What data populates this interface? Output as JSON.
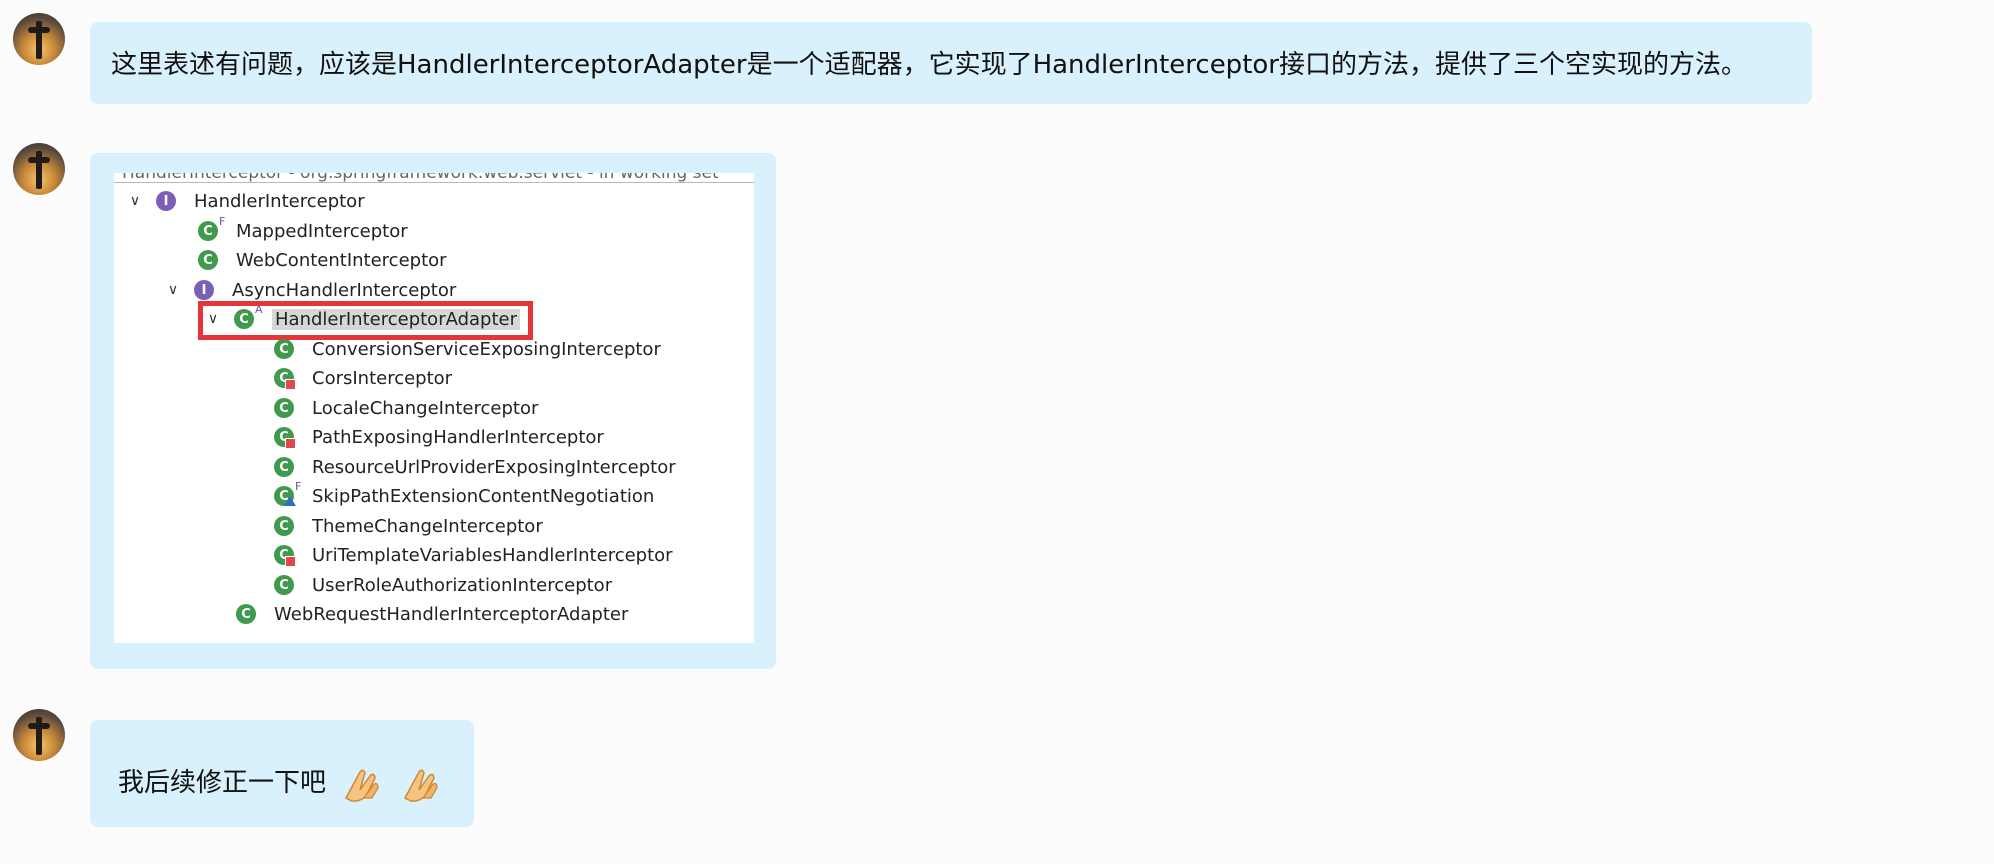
{
  "messages": [
    {
      "avatar_icon": "seattle-tower-sunset-avatar",
      "text": "这里表述有问题，应该是HandlerInterceptorAdapter是一个适配器，它实现了HandlerInterceptor接口的方法，提供了三个空实现的方法。"
    },
    {
      "avatar_icon": "seattle-tower-sunset-avatar",
      "screenshot": {
        "crumb": "HandlerInterceptor - org.springframework.web.servlet - in working set",
        "tree": [
          {
            "label": "HandlerInterceptor",
            "icon": "interface-icon",
            "expanded": true
          },
          {
            "label": "MappedInterceptor",
            "icon": "class-icon",
            "modifier": "F"
          },
          {
            "label": "WebContentInterceptor",
            "icon": "class-icon"
          },
          {
            "label": "AsyncHandlerInterceptor",
            "icon": "interface-icon",
            "expanded": true
          },
          {
            "label": "HandlerInterceptorAdapter",
            "icon": "class-icon",
            "modifier": "A",
            "expanded": true,
            "selected": true
          },
          {
            "label": "ConversionServiceExposingInterceptor",
            "icon": "class-icon"
          },
          {
            "label": "CorsInterceptor",
            "icon": "class-icon",
            "badge": "private"
          },
          {
            "label": "LocaleChangeInterceptor",
            "icon": "class-icon"
          },
          {
            "label": "PathExposingHandlerInterceptor",
            "icon": "class-icon",
            "badge": "private"
          },
          {
            "label": "ResourceUrlProviderExposingInterceptor",
            "icon": "class-icon"
          },
          {
            "label": "SkipPathExtensionContentNegotiation",
            "icon": "class-icon",
            "modifier": "F",
            "badge": "package"
          },
          {
            "label": "ThemeChangeInterceptor",
            "icon": "class-icon"
          },
          {
            "label": "UriTemplateVariablesHandlerInterceptor",
            "icon": "class-icon",
            "badge": "private"
          },
          {
            "label": "UserRoleAuthorizationInterceptor",
            "icon": "class-icon"
          },
          {
            "label": "WebRequestHandlerInterceptorAdapter",
            "icon": "class-icon"
          }
        ]
      }
    },
    {
      "avatar_icon": "seattle-tower-sunset-avatar",
      "text": "我后续修正一下吧",
      "emojis": [
        "folded-hands-emoji",
        "folded-hands-emoji"
      ]
    }
  ],
  "colors": {
    "bubble": "#d9f1fc",
    "highlight": "#e7333a",
    "class_icon": "#3f9a4e",
    "interface_icon": "#7c5fb5"
  }
}
